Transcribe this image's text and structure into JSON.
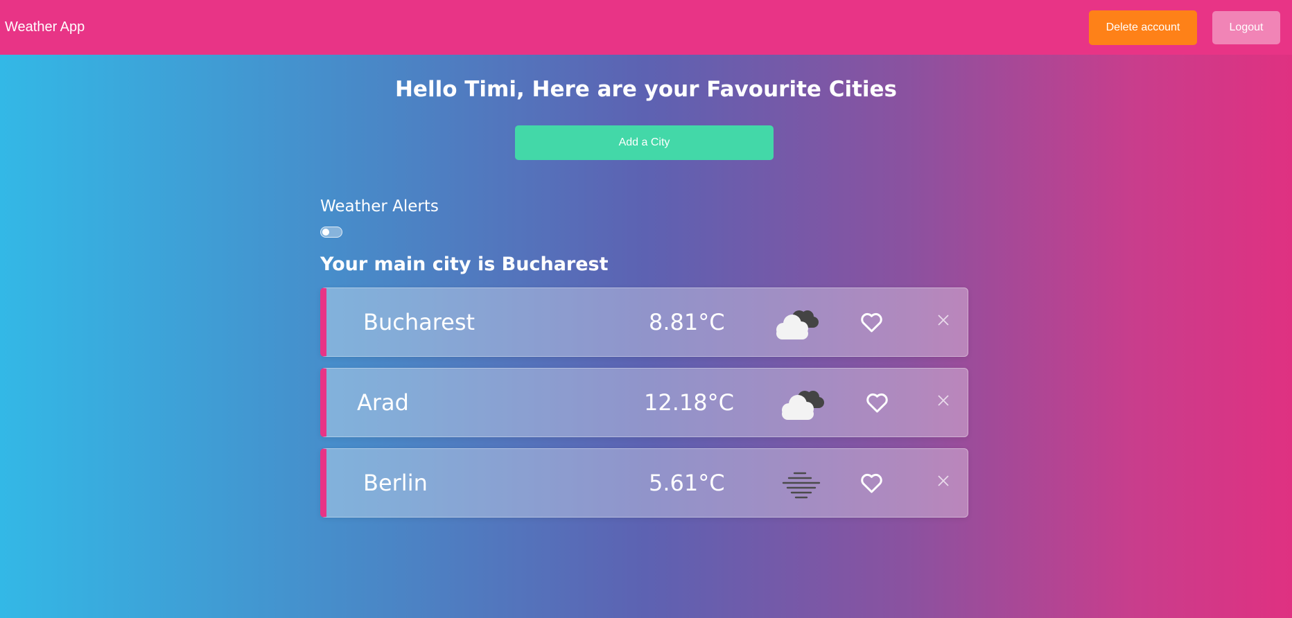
{
  "app": {
    "title": "Weather App"
  },
  "nav": {
    "delete_label": "Delete account",
    "logout_label": "Logout"
  },
  "greeting": "Hello Timi, Here are your Favourite Cities",
  "add_city_label": "Add a City",
  "alerts": {
    "label": "Weather Alerts",
    "enabled": false
  },
  "main_city_text": "Your main city is Bucharest",
  "colors": {
    "accent": "#e83486",
    "delete": "#fe8118",
    "logout": "#f184b6",
    "add": "#43d8a8"
  },
  "cities": [
    {
      "name": "Bucharest",
      "temp": "8.81°C",
      "icon": "cloudy-icon"
    },
    {
      "name": "Arad",
      "temp": "12.18°C",
      "icon": "cloudy-icon"
    },
    {
      "name": "Berlin",
      "temp": "5.61°C",
      "icon": "fog-icon"
    }
  ]
}
